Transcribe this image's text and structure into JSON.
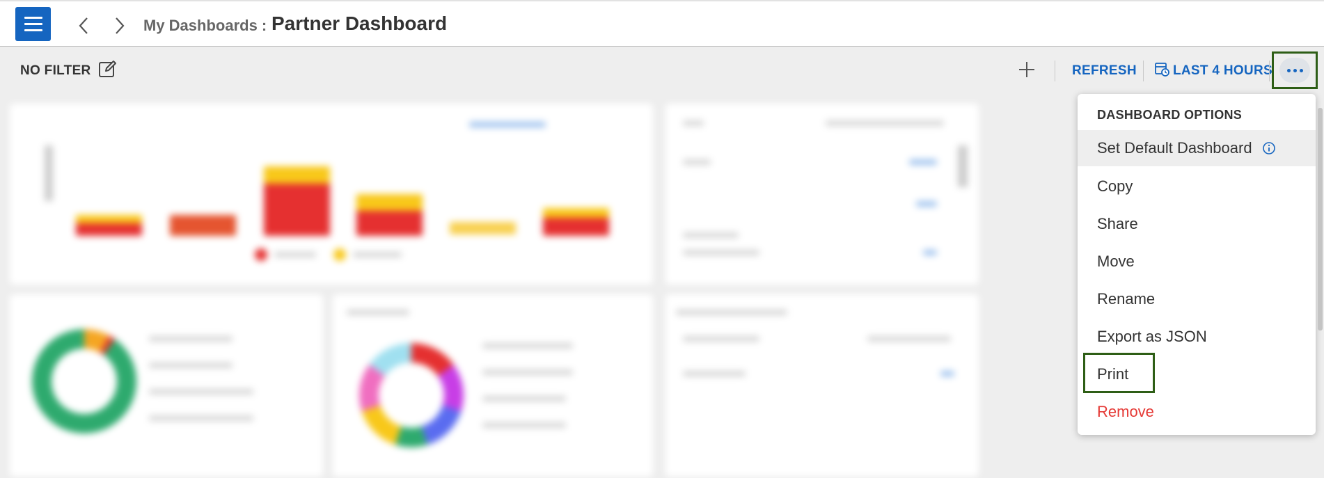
{
  "header": {
    "breadcrumb": "My Dashboards :",
    "title": "Partner Dashboard"
  },
  "toolbar": {
    "filter_label": "NO FILTER",
    "refresh_label": "REFRESH",
    "time_range_label": "LAST 4 HOURS"
  },
  "dropdown": {
    "header": "DASHBOARD OPTIONS",
    "items": [
      {
        "label": "Set Default Dashboard"
      },
      {
        "label": "Copy"
      },
      {
        "label": "Share"
      },
      {
        "label": "Move"
      },
      {
        "label": "Rename"
      },
      {
        "label": "Export as JSON"
      },
      {
        "label": "Print"
      },
      {
        "label": "Remove"
      }
    ]
  },
  "colors": {
    "accent": "#1565c0",
    "highlight_border": "#2e5e16",
    "danger": "#e53935",
    "critical": "#e53030",
    "warning": "#f8c81a"
  },
  "icons": [
    "hamburger-menu-icon",
    "chevron-left-icon",
    "chevron-right-icon",
    "edit-icon",
    "plus-icon",
    "calendar-clock-icon",
    "more-horizontal-icon",
    "info-icon"
  ]
}
